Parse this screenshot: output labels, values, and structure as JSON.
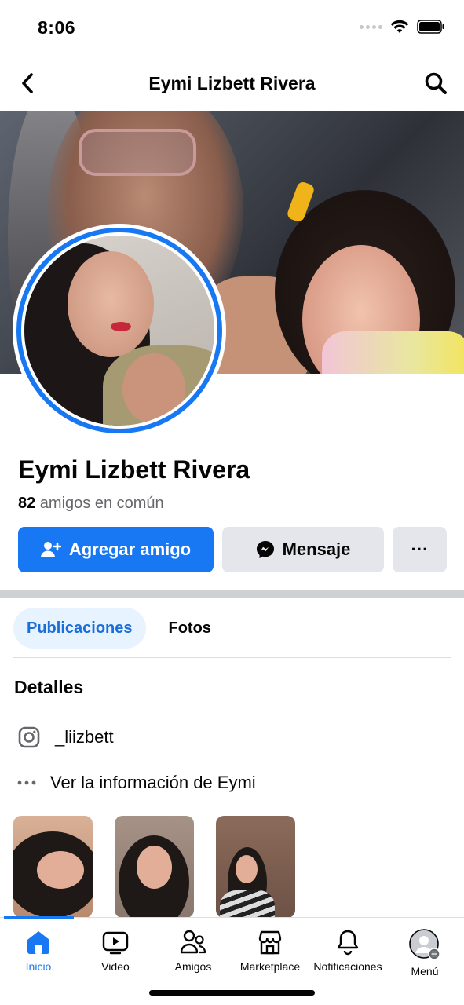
{
  "status": {
    "time": "8:06"
  },
  "header": {
    "title": "Eymi Lizbett Rivera",
    "back_icon": "chevron-left-icon",
    "search_icon": "search-icon"
  },
  "profile": {
    "name": "Eymi Lizbett Rivera",
    "mutual_count": "82",
    "mutual_text": " amigos en común"
  },
  "actions": {
    "add_friend": "Agregar amigo",
    "message": "Mensaje",
    "more": "···"
  },
  "tabs": [
    {
      "label": "Publicaciones",
      "active": true
    },
    {
      "label": "Fotos",
      "active": false
    }
  ],
  "details": {
    "title": "Detalles",
    "instagram": "_liizbett",
    "see_info": "Ver la información de Eymi"
  },
  "bottom_nav": [
    {
      "label": "Inicio",
      "icon": "home-icon",
      "active": true
    },
    {
      "label": "Video",
      "icon": "video-icon",
      "active": false
    },
    {
      "label": "Amigos",
      "icon": "friends-icon",
      "active": false
    },
    {
      "label": "Marketplace",
      "icon": "marketplace-icon",
      "active": false
    },
    {
      "label": "Notificaciones",
      "icon": "bell-icon",
      "active": false
    },
    {
      "label": "Menú",
      "icon": "avatar-menu-icon",
      "active": false
    }
  ],
  "colors": {
    "accent": "#1877f2",
    "secondary_button": "#e4e6eb",
    "active_tab_bg": "#e7f3ff"
  }
}
